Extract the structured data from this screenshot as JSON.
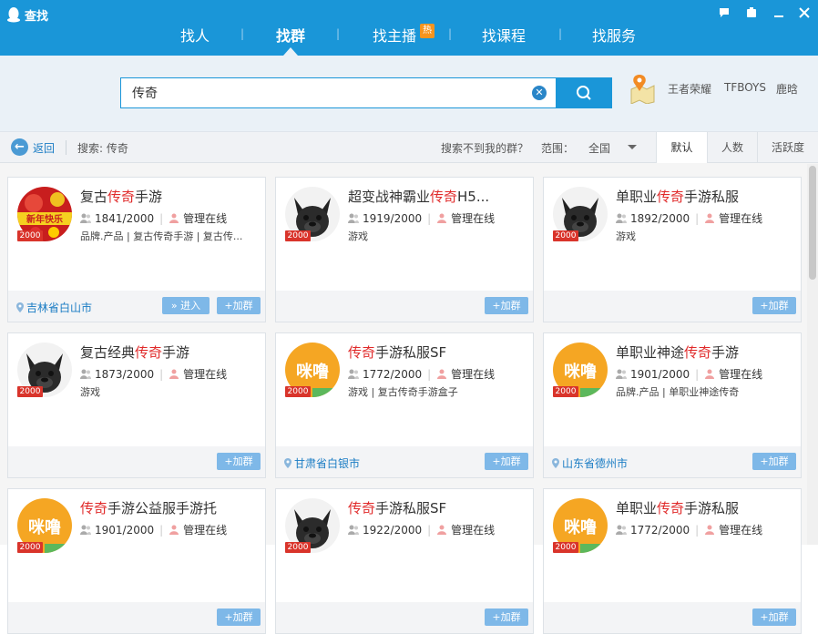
{
  "window": {
    "title": "查找"
  },
  "nav": {
    "tabs": [
      {
        "label": "找人"
      },
      {
        "label": "找群"
      },
      {
        "label": "找主播",
        "badge": "热"
      },
      {
        "label": "找课程"
      },
      {
        "label": "找服务"
      }
    ],
    "active": "找群"
  },
  "search": {
    "value": "传奇",
    "hotwords": [
      "王者荣耀",
      "TFBOYS",
      "鹿晗"
    ]
  },
  "filter": {
    "back_label": "返回",
    "search_label": "搜索: 传奇",
    "cant_find": "搜索不到我的群？",
    "range_label": "范围：",
    "range_value": "全国",
    "sort_tabs": [
      "默认",
      "人数",
      "活跃度"
    ],
    "active_sort": "默认"
  },
  "cards": [
    {
      "pre": "复古",
      "hl": "传奇",
      "post": "手游",
      "count": "1841/2000",
      "admin": "管理在线",
      "tags": "品牌.产品 | 复古传奇手游 | 复古传...",
      "location": "吉林省白山市",
      "enter": "进入",
      "join": "+加群",
      "level": "2000",
      "avatar": "festival"
    },
    {
      "pre": "超变战神霸业",
      "hl": "传奇",
      "post": "H5...",
      "count": "1919/2000",
      "admin": "管理在线",
      "tags": "游戏",
      "location": "",
      "join": "+加群",
      "level": "2000",
      "avatar": "dog"
    },
    {
      "pre": "单职业",
      "hl": "传奇",
      "post": "手游私服",
      "count": "1892/2000",
      "admin": "管理在线",
      "tags": "游戏",
      "location": "",
      "join": "+加群",
      "level": "2000",
      "avatar": "dog"
    },
    {
      "pre": "复古经典",
      "hl": "传奇",
      "post": "手游",
      "count": "1873/2000",
      "admin": "管理在线",
      "tags": "游戏",
      "location": "",
      "join": "+加群",
      "level": "2000",
      "avatar": "dog"
    },
    {
      "pre": "",
      "hl": "传奇",
      "post": "手游私服SF",
      "count": "1772/2000",
      "admin": "管理在线",
      "tags": "游戏 | 复古传奇手游盒子",
      "location": "甘肃省白银市",
      "join": "+加群",
      "level": "2000",
      "avatar": "mimi"
    },
    {
      "pre": "单职业神途",
      "hl": "传奇",
      "post": "手游",
      "count": "1901/2000",
      "admin": "管理在线",
      "tags": "品牌.产品 | 单职业神途传奇",
      "location": "山东省德州市",
      "join": "+加群",
      "level": "2000",
      "avatar": "mimi"
    },
    {
      "pre": "",
      "hl": "传奇",
      "post": "手游公益服手游托",
      "count": "1901/2000",
      "admin": "管理在线",
      "tags": "",
      "location": "",
      "join": "+加群",
      "level": "2000",
      "avatar": "mimi"
    },
    {
      "pre": "",
      "hl": "传奇",
      "post": "手游私服SF",
      "count": "1922/2000",
      "admin": "管理在线",
      "tags": "",
      "location": "",
      "join": "+加群",
      "level": "2000",
      "avatar": "dog"
    },
    {
      "pre": "单职业",
      "hl": "传奇",
      "post": "手游私服",
      "count": "1772/2000",
      "admin": "管理在线",
      "tags": "",
      "location": "",
      "join": "+加群",
      "level": "2000",
      "avatar": "mimi"
    }
  ],
  "colors": {
    "brand": "#1a96d8",
    "highlight": "#e02a2a",
    "join_button": "#7eb8e8",
    "level_badge": "#d9342b"
  }
}
